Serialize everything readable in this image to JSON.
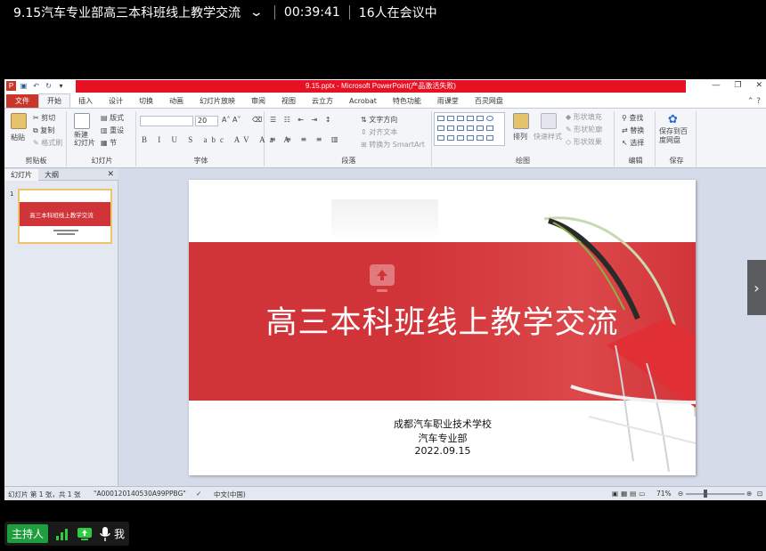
{
  "meeting": {
    "title": "9.15汽车专业部高三本科班线上教学交流",
    "timer": "00:39:41",
    "participants": "16人在会议中",
    "host_label": "主持人",
    "me_label": "我"
  },
  "ppt": {
    "window_title": "9.15.pptx - Microsoft PowerPoint(产品激活失败)",
    "tabs": [
      "文件",
      "开始",
      "插入",
      "设计",
      "切换",
      "动画",
      "幻灯片放映",
      "审阅",
      "视图",
      "云立方",
      "Acrobat",
      "特色功能",
      "雨课堂",
      "百灵网盘"
    ],
    "active_tab_index": 1,
    "ribbon": {
      "paste": "粘贴",
      "cut": "剪切",
      "copy": "复制",
      "format_painter": "格式刷",
      "clipboard": "剪贴板",
      "new_slide": "新建\n幻灯片",
      "layout": "版式",
      "reset": "重设",
      "section": "节",
      "slides": "幻灯片",
      "font_size": "20",
      "font_group": "字体",
      "text_direction": "文字方向",
      "align_text": "对齐文本",
      "smartart": "转换为 SmartArt",
      "paragraph": "段落",
      "arrange": "排列",
      "quick_styles": "快速样式",
      "shape_fill": "形状填充",
      "shape_outline": "形状轮廓",
      "shape_effects": "形状效果",
      "drawing": "绘图",
      "find": "查找",
      "replace": "替换",
      "select": "选择",
      "editing": "编辑",
      "save_to_baidu": "保存到百\n度网盘",
      "save": "保存"
    },
    "left_pane_tabs": [
      "幻灯片",
      "大纲"
    ],
    "thumb_number": "1",
    "thumb_title": "高三本科班线上教学交流",
    "slide": {
      "title": "高三本科班线上教学交流",
      "school": "成都汽车职业技术学校",
      "department": "汽车专业部",
      "date": "2022.09.15"
    },
    "status": {
      "slide_info": "幻灯片 第 1 张，共 1 张",
      "theme": "\"A000120140530A99PPBG\"",
      "language": "中文(中国)",
      "zoom": "71%"
    }
  },
  "colors": {
    "accent_red": "#d13438",
    "file_tab": "#c9372c",
    "host_green": "#1f9e3e"
  }
}
